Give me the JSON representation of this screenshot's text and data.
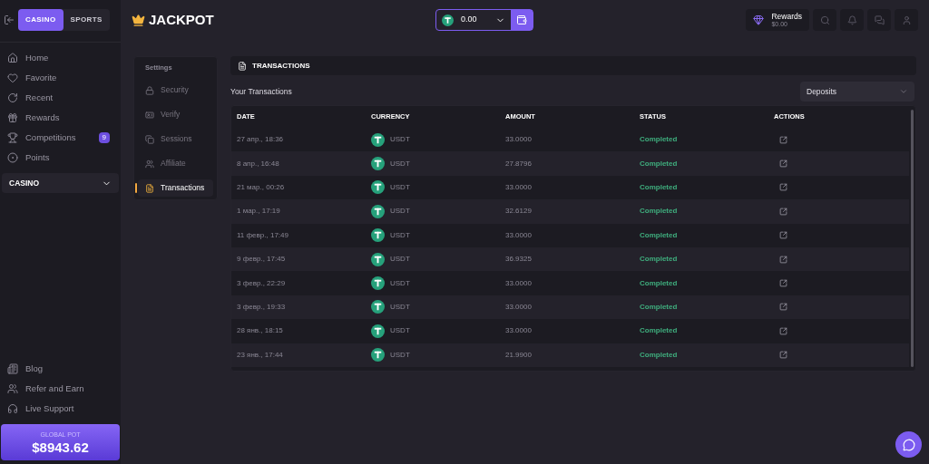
{
  "sidebar": {
    "mode_tabs": [
      {
        "label": "CASINO",
        "selected": true
      },
      {
        "label": "SPORTS",
        "selected": false
      }
    ],
    "nav": [
      {
        "label": "Home"
      },
      {
        "label": "Favorite"
      },
      {
        "label": "Recent"
      },
      {
        "label": "Rewards"
      },
      {
        "label": "Competitions",
        "badge": "9"
      },
      {
        "label": "Points"
      }
    ],
    "section": {
      "label": "CASINO",
      "expanded": false
    },
    "footer_links": [
      {
        "label": "Blog"
      },
      {
        "label": "Refer and Earn"
      },
      {
        "label": "Live Support"
      }
    ],
    "global_pot": {
      "label": "GLOBAL POT",
      "value": "$8943.62"
    }
  },
  "header": {
    "logo": "JACKPOT",
    "balance": "0.00",
    "rewards": {
      "label": "Rewards",
      "value": "$0.00"
    }
  },
  "settings": {
    "title": "Settings",
    "items": [
      {
        "label": "Security",
        "selected": false
      },
      {
        "label": "Verify",
        "selected": false
      },
      {
        "label": "Sessions",
        "selected": false
      },
      {
        "label": "Affiliate",
        "selected": false
      },
      {
        "label": "Transactions",
        "selected": true
      }
    ]
  },
  "panel": {
    "title": "TRANSACTIONS",
    "subtitle": "Your Transactions",
    "filter": "Deposits"
  },
  "table": {
    "columns": [
      "DATE",
      "CURRENCY",
      "AMOUNT",
      "STATUS",
      "ACTIONS"
    ],
    "rows": [
      {
        "date": "27 апр., 18:36",
        "currency": "USDT",
        "amount": "33.0000",
        "status": "Completed"
      },
      {
        "date": "8 апр., 16:48",
        "currency": "USDT",
        "amount": "27.8796",
        "status": "Completed"
      },
      {
        "date": "21 мар., 00:26",
        "currency": "USDT",
        "amount": "33.0000",
        "status": "Completed"
      },
      {
        "date": "1 мар., 17:19",
        "currency": "USDT",
        "amount": "32.6129",
        "status": "Completed"
      },
      {
        "date": "11 февр., 17:49",
        "currency": "USDT",
        "amount": "33.0000",
        "status": "Completed"
      },
      {
        "date": "9 февр., 17:45",
        "currency": "USDT",
        "amount": "36.9325",
        "status": "Completed"
      },
      {
        "date": "3 февр., 22:29",
        "currency": "USDT",
        "amount": "33.0000",
        "status": "Completed"
      },
      {
        "date": "3 февр., 19:33",
        "currency": "USDT",
        "amount": "33.0000",
        "status": "Completed"
      },
      {
        "date": "28 янв., 18:15",
        "currency": "USDT",
        "amount": "33.0000",
        "status": "Completed"
      },
      {
        "date": "23 янв., 17:44",
        "currency": "USDT",
        "amount": "21.9900",
        "status": "Completed"
      }
    ]
  }
}
